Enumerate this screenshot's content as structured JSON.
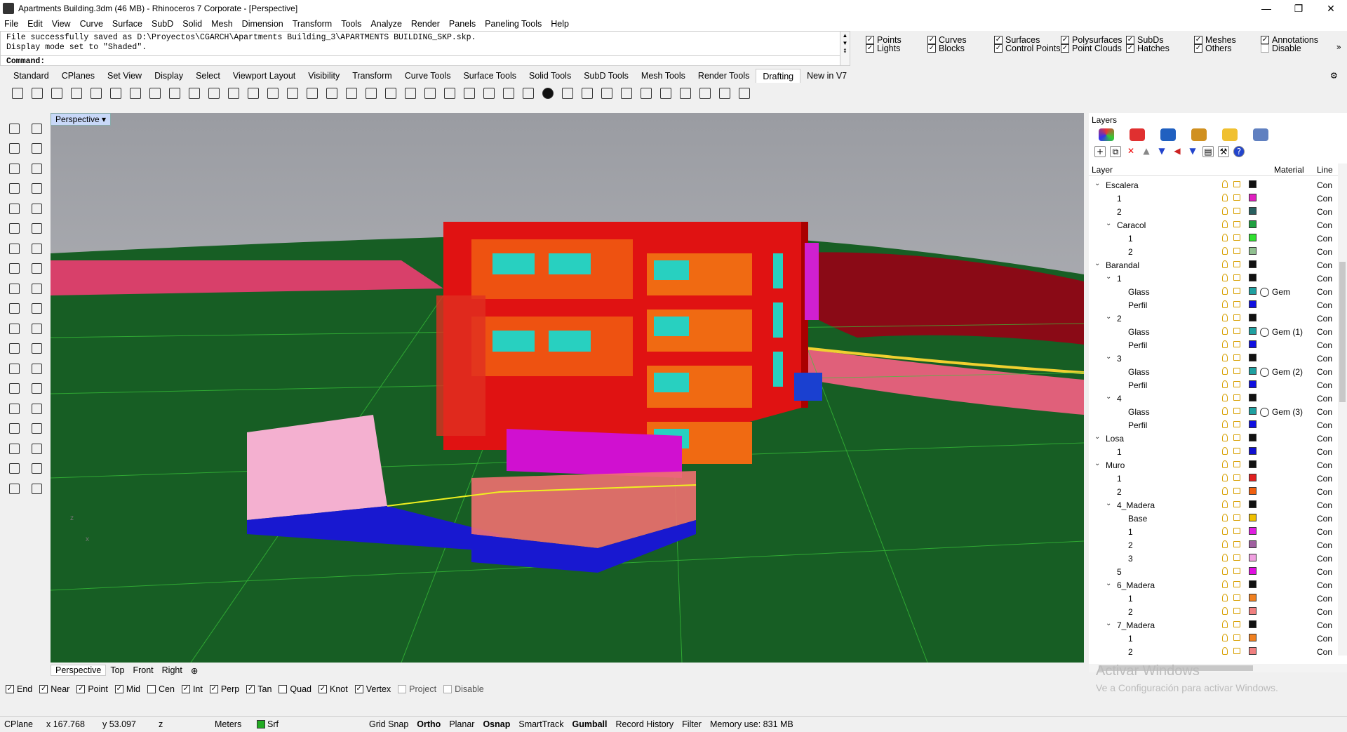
{
  "window": {
    "title": "Apartments Building.3dm (46 MB) - Rhinoceros 7 Corporate - [Perspective]"
  },
  "menu": [
    "File",
    "Edit",
    "View",
    "Curve",
    "Surface",
    "SubD",
    "Solid",
    "Mesh",
    "Dimension",
    "Transform",
    "Tools",
    "Analyze",
    "Render",
    "Panels",
    "Paneling Tools",
    "Help"
  ],
  "command": {
    "history": [
      "File successfully saved as D:\\Proyectos\\CGARCH\\Apartments Building_3\\APARTMENTS BUILDING_SKP.skp.",
      "Display mode set to \"Shaded\"."
    ],
    "prompt": "Command:"
  },
  "filters": [
    {
      "label": "Points",
      "checked": true
    },
    {
      "label": "Curves",
      "checked": true
    },
    {
      "label": "Surfaces",
      "checked": true
    },
    {
      "label": "Polysurfaces",
      "checked": true
    },
    {
      "label": "SubDs",
      "checked": true
    },
    {
      "label": "Meshes",
      "checked": true
    },
    {
      "label": "Annotations",
      "checked": true
    },
    {
      "label": "Lights",
      "checked": true
    },
    {
      "label": "Blocks",
      "checked": true
    },
    {
      "label": "Control Points",
      "checked": true
    },
    {
      "label": "Point Clouds",
      "checked": true
    },
    {
      "label": "Hatches",
      "checked": true
    },
    {
      "label": "Others",
      "checked": true
    },
    {
      "label": "Disable",
      "checked": false
    }
  ],
  "toolbar_tabs": [
    {
      "label": "Standard",
      "active": false
    },
    {
      "label": "CPlanes",
      "active": false
    },
    {
      "label": "Set View",
      "active": false
    },
    {
      "label": "Display",
      "active": false
    },
    {
      "label": "Select",
      "active": false
    },
    {
      "label": "Viewport Layout",
      "active": false
    },
    {
      "label": "Visibility",
      "active": false
    },
    {
      "label": "Transform",
      "active": false
    },
    {
      "label": "Curve Tools",
      "active": false
    },
    {
      "label": "Surface Tools",
      "active": false
    },
    {
      "label": "Solid Tools",
      "active": false
    },
    {
      "label": "SubD Tools",
      "active": false
    },
    {
      "label": "Mesh Tools",
      "active": false
    },
    {
      "label": "Render Tools",
      "active": false
    },
    {
      "label": "Drafting",
      "active": true
    },
    {
      "label": "New in V7",
      "active": false
    }
  ],
  "viewport": {
    "name": "Perspective",
    "dropdown_glyph": "▾"
  },
  "view_tabs": [
    "Perspective",
    "Top",
    "Front",
    "Right",
    "⊕"
  ],
  "osnaps": [
    {
      "label": "End",
      "checked": true
    },
    {
      "label": "Near",
      "checked": true
    },
    {
      "label": "Point",
      "checked": true
    },
    {
      "label": "Mid",
      "checked": true
    },
    {
      "label": "Cen",
      "checked": false
    },
    {
      "label": "Int",
      "checked": true
    },
    {
      "label": "Perp",
      "checked": true
    },
    {
      "label": "Tan",
      "checked": true
    },
    {
      "label": "Quad",
      "checked": false
    },
    {
      "label": "Knot",
      "checked": true
    },
    {
      "label": "Vertex",
      "checked": true
    },
    {
      "label": "Project",
      "checked": false,
      "disabled": true
    },
    {
      "label": "Disable",
      "checked": false,
      "disabled": true
    }
  ],
  "status": {
    "cplane": "CPlane",
    "x": "x 167.768",
    "y": "y 53.097",
    "z": "z",
    "units": "Meters",
    "layer": "Srf",
    "toggles": [
      {
        "label": "Grid Snap",
        "bold": false
      },
      {
        "label": "Ortho",
        "bold": true
      },
      {
        "label": "Planar",
        "bold": false
      },
      {
        "label": "Osnap",
        "bold": true
      },
      {
        "label": "SmartTrack",
        "bold": false
      },
      {
        "label": "Gumball",
        "bold": true
      },
      {
        "label": "Record History",
        "bold": false
      },
      {
        "label": "Filter",
        "bold": false
      }
    ],
    "memory": "Memory use: 831 MB"
  },
  "layers": {
    "title": "Layers",
    "columns": {
      "layer": "Layer",
      "material": "Material",
      "linetype": "Line"
    },
    "rows": [
      {
        "name": "Escalera",
        "level": 0,
        "expanded": true,
        "color": "#111111",
        "material": "",
        "linetype": "Con"
      },
      {
        "name": "1",
        "level": 1,
        "expanded": null,
        "color": "#e020c0",
        "material": "",
        "linetype": "Con"
      },
      {
        "name": "2",
        "level": 1,
        "expanded": null,
        "color": "#2a6060",
        "material": "",
        "linetype": "Con"
      },
      {
        "name": "Caracol",
        "level": 1,
        "expanded": true,
        "color": "#20a040",
        "material": "",
        "linetype": "Con"
      },
      {
        "name": "1",
        "level": 2,
        "expanded": null,
        "color": "#30e030",
        "material": "",
        "linetype": "Con"
      },
      {
        "name": "2",
        "level": 2,
        "expanded": null,
        "color": "#90c090",
        "material": "",
        "linetype": "Con"
      },
      {
        "name": "Barandal",
        "level": 0,
        "expanded": true,
        "color": "#111111",
        "material": "",
        "linetype": "Con"
      },
      {
        "name": "1",
        "level": 1,
        "expanded": true,
        "color": "#111111",
        "material": "",
        "linetype": "Con"
      },
      {
        "name": "Glass",
        "level": 2,
        "expanded": null,
        "color": "#20a0a0",
        "material": "Gem",
        "linetype": "Con"
      },
      {
        "name": "Perfil",
        "level": 2,
        "expanded": null,
        "color": "#1010e0",
        "material": "",
        "linetype": "Con"
      },
      {
        "name": "2",
        "level": 1,
        "expanded": true,
        "color": "#111111",
        "material": "",
        "linetype": "Con"
      },
      {
        "name": "Glass",
        "level": 2,
        "expanded": null,
        "color": "#20a0a0",
        "material": "Gem (1)",
        "linetype": "Con"
      },
      {
        "name": "Perfil",
        "level": 2,
        "expanded": null,
        "color": "#1010e0",
        "material": "",
        "linetype": "Con"
      },
      {
        "name": "3",
        "level": 1,
        "expanded": true,
        "color": "#111111",
        "material": "",
        "linetype": "Con"
      },
      {
        "name": "Glass",
        "level": 2,
        "expanded": null,
        "color": "#20a0a0",
        "material": "Gem (2)",
        "linetype": "Con"
      },
      {
        "name": "Perfil",
        "level": 2,
        "expanded": null,
        "color": "#1010e0",
        "material": "",
        "linetype": "Con"
      },
      {
        "name": "4",
        "level": 1,
        "expanded": true,
        "color": "#111111",
        "material": "",
        "linetype": "Con"
      },
      {
        "name": "Glass",
        "level": 2,
        "expanded": null,
        "color": "#20a0a0",
        "material": "Gem (3)",
        "linetype": "Con"
      },
      {
        "name": "Perfil",
        "level": 2,
        "expanded": null,
        "color": "#1010e0",
        "material": "",
        "linetype": "Con"
      },
      {
        "name": "Losa",
        "level": 0,
        "expanded": true,
        "color": "#111111",
        "material": "",
        "linetype": "Con"
      },
      {
        "name": "1",
        "level": 1,
        "expanded": null,
        "color": "#1010d0",
        "material": "",
        "linetype": "Con"
      },
      {
        "name": "Muro",
        "level": 0,
        "expanded": true,
        "color": "#111111",
        "material": "",
        "linetype": "Con"
      },
      {
        "name": "1",
        "level": 1,
        "expanded": null,
        "color": "#e02020",
        "material": "",
        "linetype": "Con"
      },
      {
        "name": "2",
        "level": 1,
        "expanded": null,
        "color": "#f06010",
        "material": "",
        "linetype": "Con"
      },
      {
        "name": "4_Madera",
        "level": 1,
        "expanded": true,
        "color": "#111111",
        "material": "",
        "linetype": "Con"
      },
      {
        "name": "Base",
        "level": 2,
        "expanded": null,
        "color": "#f0c000",
        "material": "",
        "linetype": "Con"
      },
      {
        "name": "1",
        "level": 2,
        "expanded": null,
        "color": "#e020e0",
        "material": "",
        "linetype": "Con"
      },
      {
        "name": "2",
        "level": 2,
        "expanded": null,
        "color": "#a060a0",
        "material": "",
        "linetype": "Con"
      },
      {
        "name": "3",
        "level": 2,
        "expanded": null,
        "color": "#f0a0e0",
        "material": "",
        "linetype": "Con"
      },
      {
        "name": "5",
        "level": 1,
        "expanded": null,
        "color": "#e010e0",
        "material": "",
        "linetype": "Con"
      },
      {
        "name": "6_Madera",
        "level": 1,
        "expanded": true,
        "color": "#111111",
        "material": "",
        "linetype": "Con"
      },
      {
        "name": "1",
        "level": 2,
        "expanded": null,
        "color": "#f08020",
        "material": "",
        "linetype": "Con"
      },
      {
        "name": "2",
        "level": 2,
        "expanded": null,
        "color": "#f08080",
        "material": "",
        "linetype": "Con"
      },
      {
        "name": "7_Madera",
        "level": 1,
        "expanded": true,
        "color": "#111111",
        "material": "",
        "linetype": "Con"
      },
      {
        "name": "1",
        "level": 2,
        "expanded": null,
        "color": "#f08020",
        "material": "",
        "linetype": "Con"
      },
      {
        "name": "2",
        "level": 2,
        "expanded": null,
        "color": "#f08080",
        "material": "",
        "linetype": "Con"
      }
    ]
  },
  "watermark": {
    "line1": "Activar Windows",
    "line2": "Ve a Configuración para activar Windows."
  }
}
